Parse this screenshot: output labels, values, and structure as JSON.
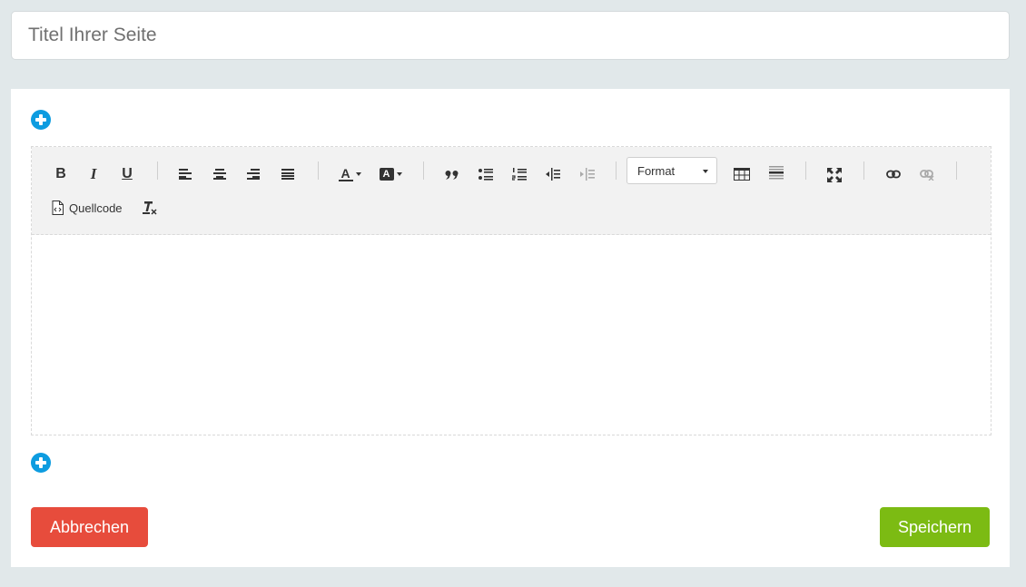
{
  "title_field": {
    "placeholder": "Titel Ihrer Seite",
    "value": ""
  },
  "toolbar": {
    "buttons": [
      {
        "name": "bold",
        "icon": "bold-icon",
        "label": "B"
      },
      {
        "name": "italic",
        "icon": "italic-icon",
        "label": "I"
      },
      {
        "name": "underline",
        "icon": "underline-icon",
        "label": "U"
      },
      {
        "name": "align-left",
        "icon": "align-left-icon"
      },
      {
        "name": "align-center",
        "icon": "align-center-icon"
      },
      {
        "name": "align-right",
        "icon": "align-right-icon"
      },
      {
        "name": "align-justify",
        "icon": "align-justify-icon"
      },
      {
        "name": "text-color",
        "icon": "text-color-icon",
        "label": "A"
      },
      {
        "name": "background-color",
        "icon": "background-color-icon",
        "label": "A"
      },
      {
        "name": "blockquote",
        "icon": "quote-icon"
      },
      {
        "name": "bullet-list",
        "icon": "bullet-list-icon"
      },
      {
        "name": "numbered-list",
        "icon": "numbered-list-icon"
      },
      {
        "name": "outdent",
        "icon": "outdent-icon"
      },
      {
        "name": "indent",
        "icon": "indent-icon",
        "disabled": true
      },
      {
        "name": "table",
        "icon": "table-icon"
      },
      {
        "name": "horizontal-rule",
        "icon": "horizontal-rule-icon"
      },
      {
        "name": "fullscreen",
        "icon": "fullscreen-icon"
      },
      {
        "name": "link",
        "icon": "link-icon"
      },
      {
        "name": "unlink",
        "icon": "unlink-icon",
        "disabled": true
      },
      {
        "name": "source-code",
        "icon": "source-code-icon"
      },
      {
        "name": "clear-formatting",
        "icon": "clear-formatting-icon"
      }
    ],
    "format_select": {
      "value": "Format"
    },
    "source_label": "Quellcode"
  },
  "actions": {
    "cancel_label": "Abbrechen",
    "save_label": "Speichern"
  },
  "colors": {
    "background": "#e1e8ea",
    "accent_blue": "#0d9ce0",
    "cancel_red": "#e74c3c",
    "save_green": "#7cbb13",
    "toolbar_bg": "#f2f2f2"
  }
}
